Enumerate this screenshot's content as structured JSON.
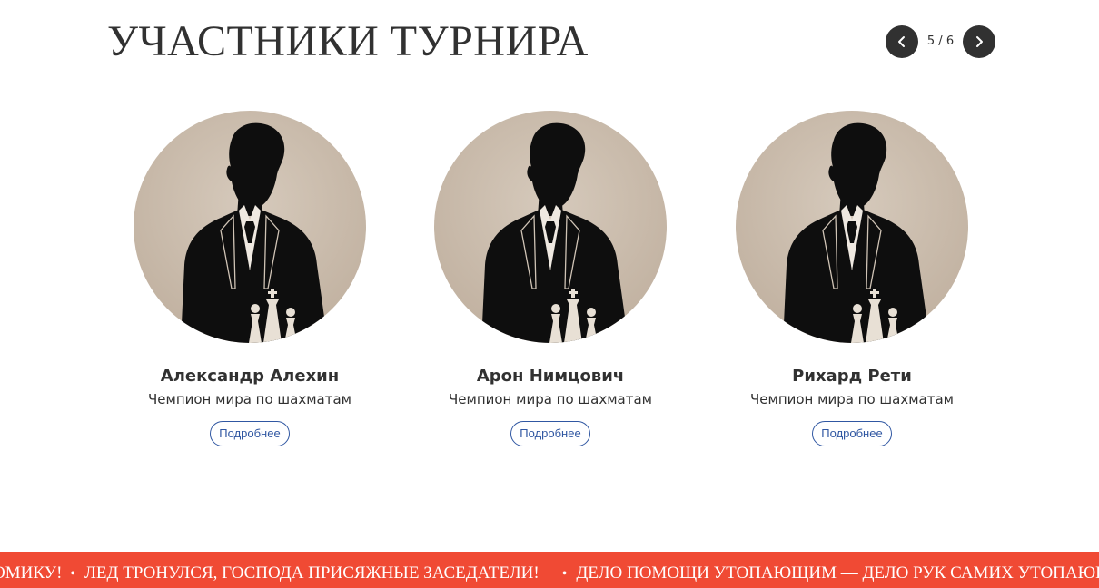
{
  "section": {
    "title": "УЧАСТНИКИ ТУРНИРА"
  },
  "pager": {
    "counter": "5 / 6",
    "prev_icon": "chevron-left-icon",
    "next_icon": "chevron-right-icon"
  },
  "participants": [
    {
      "name": "Александр Алехин",
      "role": "Чемпион мира по шахматам",
      "button": "Подробнее",
      "photo": "chess-player-silhouette"
    },
    {
      "name": "Арон Нимцович",
      "role": "Чемпион мира по шахматам",
      "button": "Подробнее",
      "photo": "chess-player-silhouette"
    },
    {
      "name": "Рихард Рети",
      "role": "Чемпион мира по шахматам",
      "button": "Подробнее",
      "photo": "chess-player-silhouette"
    }
  ],
  "ticker": {
    "items": [
      "ОМИКУ!",
      "ЛЕД ТРОНУЛСЯ, ГОСПОДА ПРИСЯЖНЫЕ ЗАСЕДАТЕЛИ!",
      "ДЕЛО ПОМОЩИ УТОПАЮЩИМ — ДЕЛО РУК САМИХ УТОПАЮЩИХ"
    ],
    "separator": "•"
  },
  "colors": {
    "text": "#313131",
    "ticker_bg": "#f04a34",
    "button_accent": "#3057a2",
    "avatar_bg": "#cbbdae"
  }
}
